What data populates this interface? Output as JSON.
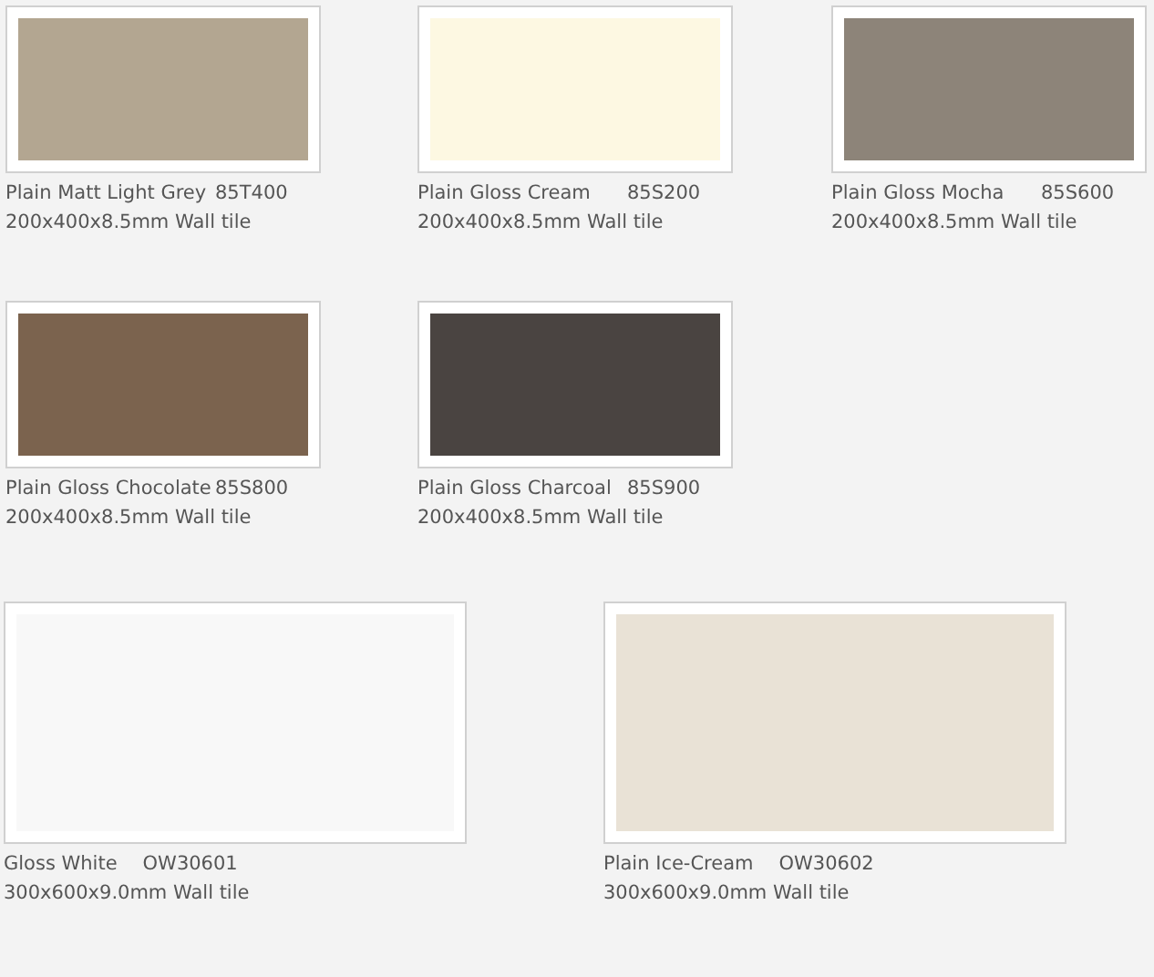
{
  "rows": [
    {
      "kind": "small",
      "tiles": [
        {
          "name": "Plain Matt Light Grey",
          "code": "85T400",
          "spec": "200x400x8.5mm Wall tile",
          "color": "#b3a691"
        },
        {
          "name": "Plain Gloss Cream",
          "code": "85S200",
          "spec": "200x400x8.5mm Wall tile",
          "color": "#fdf8e2"
        },
        {
          "name": "Plain Gloss Mocha",
          "code": "85S600",
          "spec": "200x400x8.5mm Wall tile",
          "color": "#8d8479"
        }
      ]
    },
    {
      "kind": "small",
      "tiles": [
        {
          "name": "Plain Gloss Chocolate",
          "code": "85S800",
          "spec": "200x400x8.5mm Wall tile",
          "color": "#7b634e"
        },
        {
          "name": "Plain Gloss Charcoal",
          "code": "85S900",
          "spec": "200x400x8.5mm Wall tile",
          "color": "#4a4441"
        }
      ]
    },
    {
      "kind": "large",
      "tiles": [
        {
          "name": "Gloss White",
          "code": "OW30601",
          "spec": "300x600x9.0mm Wall tile",
          "color": "#f8f8f8"
        },
        {
          "name": "Plain Ice-Cream",
          "code": "OW30602",
          "spec": "300x600x9.0mm Wall tile",
          "color": "#e9e2d6"
        }
      ]
    }
  ]
}
